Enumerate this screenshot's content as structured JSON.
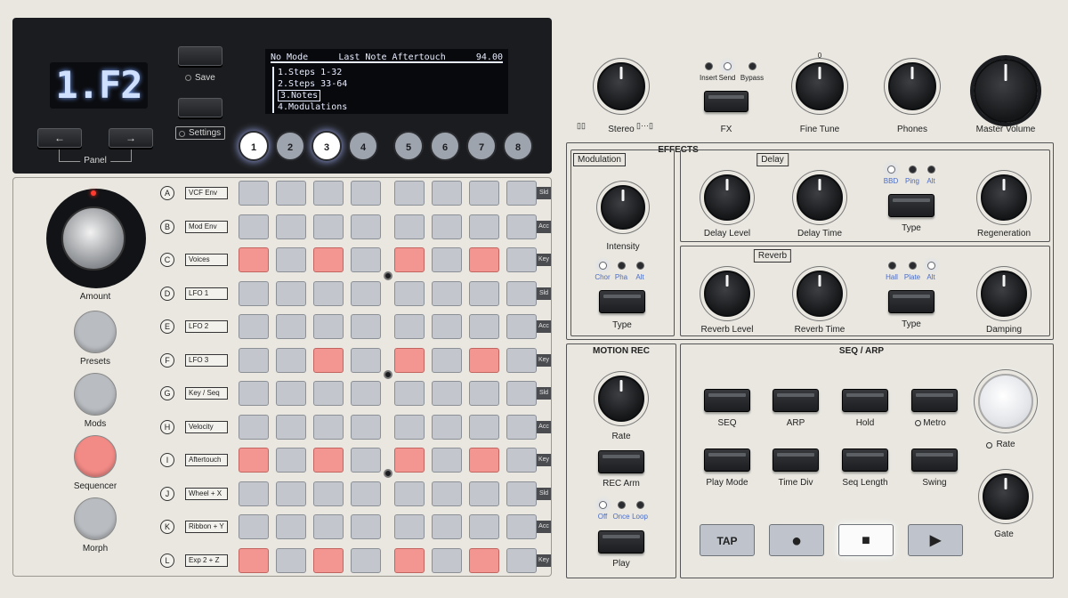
{
  "display": {
    "segment": "1.F2",
    "oled": {
      "mode": "No Mode",
      "param": "Last Note Aftertouch",
      "value": "94.00",
      "items": [
        "1.Steps 1-32",
        "2.Steps 33-64",
        "3.Notes",
        "4.Modulations"
      ],
      "selected_index": 2
    },
    "save_label": "Save",
    "settings_label": "Settings",
    "panel_label": "Panel",
    "panel_left": "←",
    "panel_right": "→",
    "buttons": [
      {
        "label": "1",
        "lit": true
      },
      {
        "label": "2",
        "lit": false
      },
      {
        "label": "3",
        "lit": true
      },
      {
        "label": "4",
        "lit": false
      },
      {
        "label": "5",
        "lit": false
      },
      {
        "label": "6",
        "lit": false
      },
      {
        "label": "7",
        "lit": false
      },
      {
        "label": "8",
        "lit": false
      }
    ]
  },
  "left": {
    "amount": "Amount",
    "presets": "Presets",
    "mods": "Mods",
    "sequencer": "Sequencer",
    "morph": "Morph"
  },
  "matrix": {
    "rows": [
      {
        "letter": "A",
        "label": "VCF Env",
        "tag": "Sld",
        "red": []
      },
      {
        "letter": "B",
        "label": "Mod Env",
        "tag": "Acc",
        "red": []
      },
      {
        "letter": "C",
        "label": "Voices",
        "tag": "Key",
        "red": [
          0,
          2,
          4,
          6
        ]
      },
      {
        "letter": "D",
        "label": "LFO 1",
        "tag": "Sld",
        "red": []
      },
      {
        "letter": "E",
        "label": "LFO 2",
        "tag": "Acc",
        "red": []
      },
      {
        "letter": "F",
        "label": "LFO 3",
        "tag": "Key",
        "red": [
          2,
          4,
          6
        ]
      },
      {
        "letter": "G",
        "label": "Key / Seq",
        "tag": "Sld",
        "red": []
      },
      {
        "letter": "H",
        "label": "Velocity",
        "tag": "Acc",
        "red": []
      },
      {
        "letter": "I",
        "label": "Aftertouch",
        "tag": "Key",
        "red": [
          0,
          2,
          4,
          6
        ]
      },
      {
        "letter": "J",
        "label": "Wheel + X",
        "tag": "Sld",
        "red": []
      },
      {
        "letter": "K",
        "label": "Ribbon + Y",
        "tag": "Acc",
        "red": []
      },
      {
        "letter": "L",
        "label": "Exp 2 + Z",
        "tag": "Key",
        "red": [
          0,
          2,
          4,
          6
        ]
      }
    ]
  },
  "top_right": {
    "stereo": "Stereo",
    "stereo_left_glyph": "▯▯",
    "stereo_right_glyph": "▯···▯",
    "fx": "FX",
    "fx_leds": [
      "Insert",
      "Send",
      "Bypass"
    ],
    "fx_active": "Send",
    "fine_tune": "Fine Tune",
    "fine_tune_zero": "0",
    "phones": "Phones",
    "master_volume": "Master Volume"
  },
  "effects": {
    "title": "EFFECTS",
    "modulation": {
      "title": "Modulation",
      "intensity": "Intensity",
      "types": [
        "Chor",
        "Pha",
        "Alt"
      ],
      "type_label": "Type"
    },
    "delay": {
      "title": "Delay",
      "level": "Delay Level",
      "time": "Delay Time",
      "types": [
        "BBD",
        "Ping",
        "Alt"
      ],
      "active": "BBD",
      "type_label": "Type",
      "regeneration": "Regeneration"
    },
    "reverb": {
      "title": "Reverb",
      "level": "Reverb Level",
      "time": "Reverb Time",
      "types": [
        "Hall",
        "Plate",
        "Alt"
      ],
      "active": "Alt",
      "type_label": "Type",
      "damping": "Damping"
    }
  },
  "motion_rec": {
    "title": "MOTION REC",
    "rate": "Rate",
    "rec_arm": "REC Arm",
    "modes": [
      "Off",
      "Once",
      "Loop"
    ],
    "active": "Off",
    "play": "Play"
  },
  "seq_arp": {
    "title": "SEQ / ARP",
    "row1": [
      "SEQ",
      "ARP",
      "Hold",
      "Metro"
    ],
    "row2": [
      "Play Mode",
      "Time Div",
      "Seq Length",
      "Swing"
    ],
    "rate": "Rate",
    "gate": "Gate",
    "tap": "TAP",
    "record_glyph": "●",
    "stop_glyph": "■",
    "play_glyph": "▶"
  }
}
